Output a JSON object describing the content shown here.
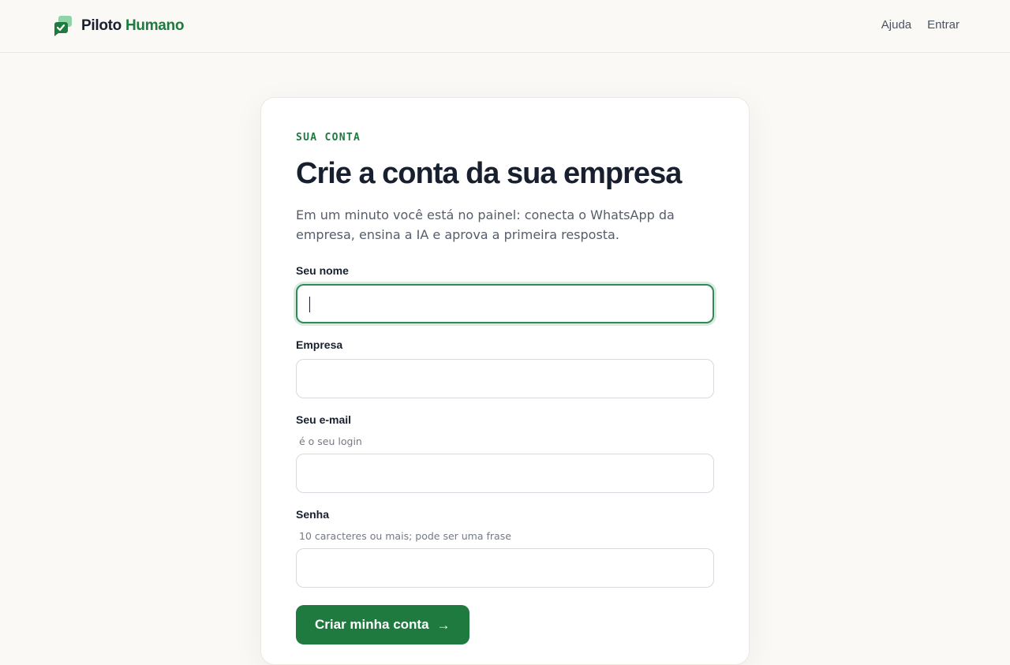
{
  "header": {
    "brand_part1": "Piloto",
    "brand_part2": "Humano",
    "nav": [
      {
        "label": "Ajuda"
      },
      {
        "label": "Entrar"
      }
    ]
  },
  "colors": {
    "accent": "#1f7a3f",
    "logo_light": "#8fd3a6",
    "logo_dark": "#1f7a3f"
  },
  "form": {
    "eyebrow": "SUA CONTA",
    "title": "Crie a conta da sua empresa",
    "subtitle": "Em um minuto você está no painel: conecta o WhatsApp da empresa, ensina a IA e aprova a primeira resposta.",
    "fields": [
      {
        "label": "Seu nome",
        "value": "",
        "hint": ""
      },
      {
        "label": "Empresa",
        "value": "",
        "hint": ""
      },
      {
        "label": "Seu e-mail",
        "value": "",
        "hint": "é o seu login"
      },
      {
        "label": "Senha",
        "value": "",
        "hint": "10 caracteres ou mais; pode ser uma frase"
      }
    ],
    "submit_label": "Criar minha conta",
    "submit_icon": "arrow-right-icon"
  }
}
